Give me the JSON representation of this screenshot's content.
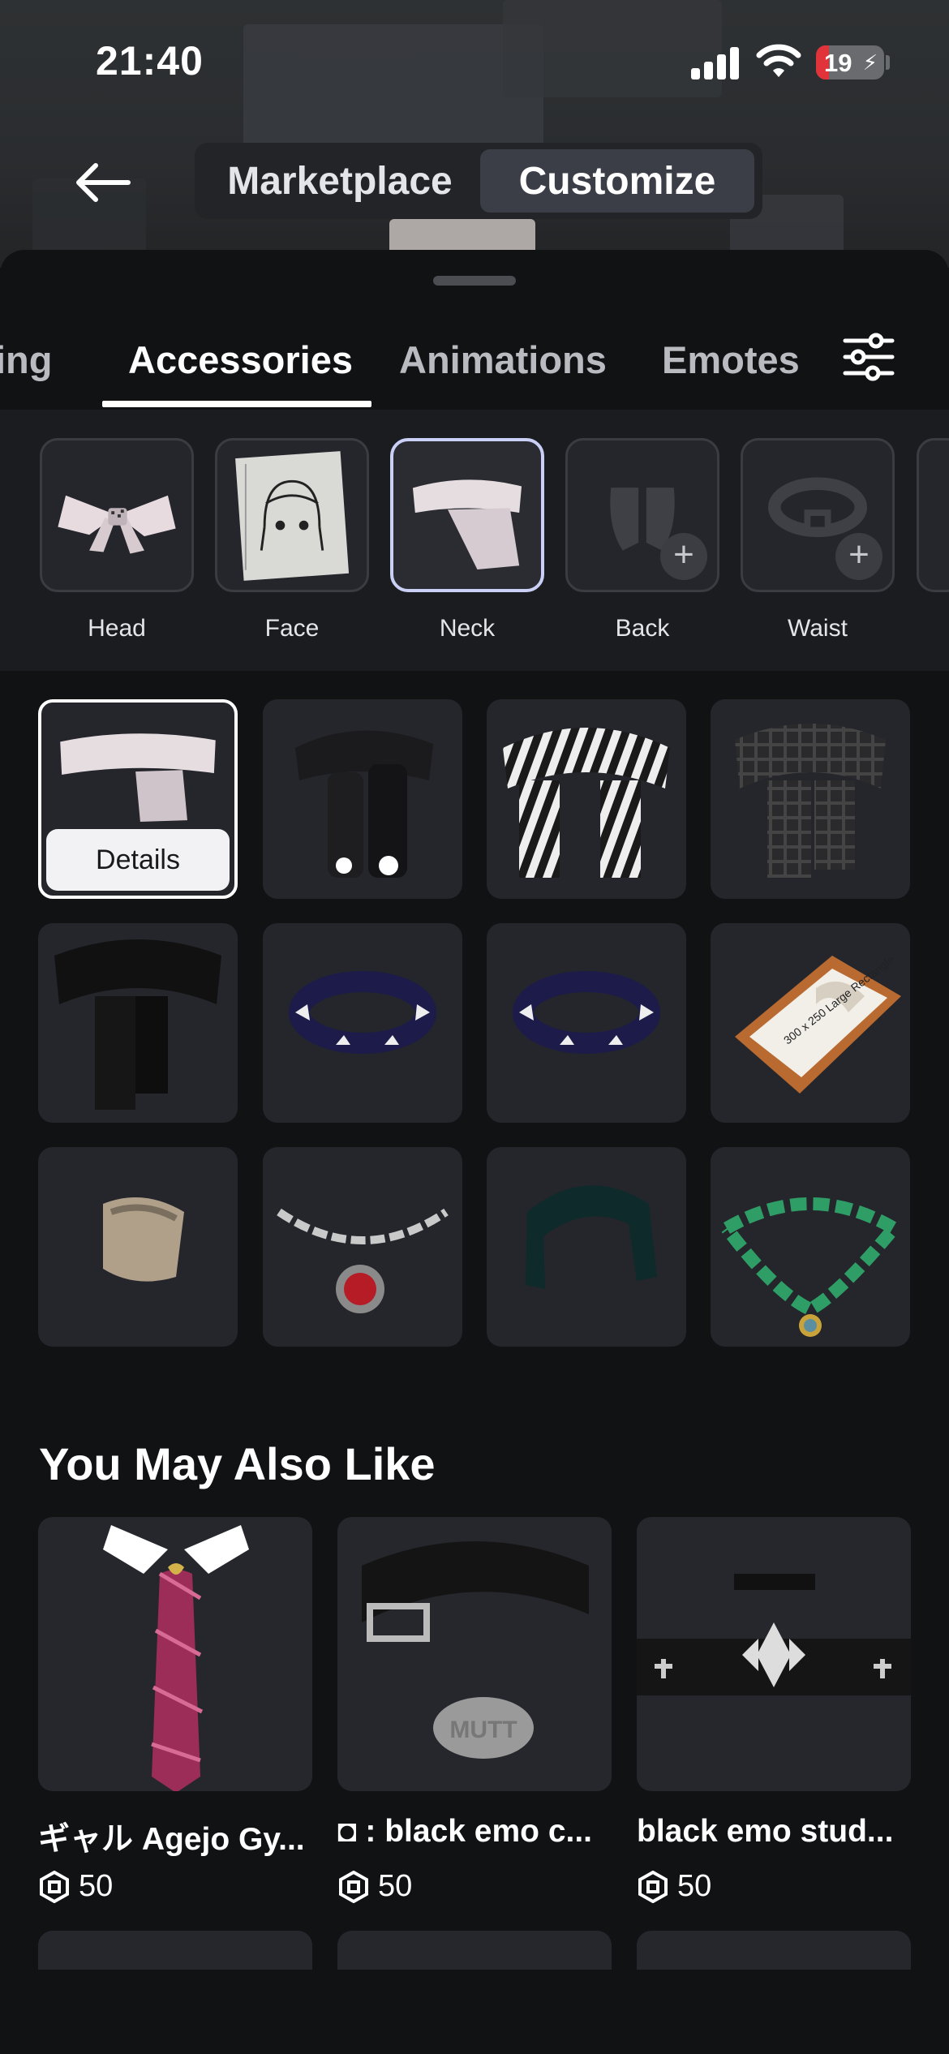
{
  "status": {
    "time": "21:40",
    "battery": "19",
    "battery_level": 0.19
  },
  "header": {
    "segments": [
      "Marketplace",
      "Customize"
    ],
    "active_segment": "Customize"
  },
  "tabs": {
    "partial": "ing",
    "items": [
      "Accessories",
      "Animations",
      "Emotes"
    ],
    "active": "Accessories"
  },
  "categories": [
    {
      "label": "Head",
      "state": "filled"
    },
    {
      "label": "Face",
      "state": "filled"
    },
    {
      "label": "Neck",
      "state": "selected"
    },
    {
      "label": "Back",
      "state": "empty"
    },
    {
      "label": "Waist",
      "state": "empty"
    }
  ],
  "items": {
    "details_label": "Details",
    "list": [
      "neck-sleeve-pink",
      "black-paw-scarf",
      "striped-scarf",
      "plaid-scarf",
      "black-scarf",
      "spiked-collar-navy",
      "spiked-collar-navy-2",
      "large-rectangle-frame",
      "beige-neck-wrap",
      "chain-necklace-red",
      "teal-neck-wrap",
      "green-bead-necklace"
    ],
    "frame_text": "300 x 250 Large Rectangle"
  },
  "recommendations": {
    "title": "You May Also Like",
    "items": [
      {
        "name": "ギャル Agejo Gy...",
        "price": "50"
      },
      {
        "name": ": black emo c...",
        "price": "50"
      },
      {
        "name": "black emo stud...",
        "price": "50"
      }
    ],
    "tag_text": "MUTT"
  },
  "colors": {
    "background": "#111214",
    "panel": "#24262c",
    "accent_outline": "#c9cff5"
  }
}
